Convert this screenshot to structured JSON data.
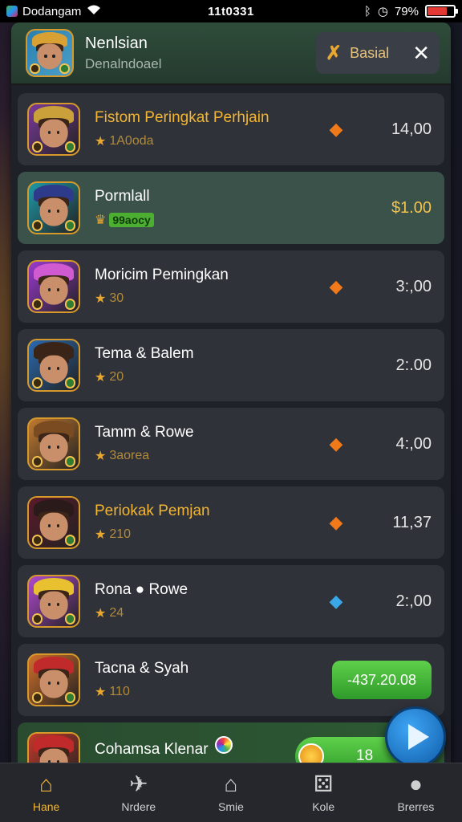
{
  "status_bar": {
    "carrier": "Dodangam",
    "time": "11t0331",
    "battery_text": "79%",
    "battery_level": 0.79
  },
  "header": {
    "title": "Nenlsian",
    "subtitle": "Denalndoael",
    "button_label": "Basial",
    "close_symbol": "✕"
  },
  "rows": [
    {
      "name": "Fistom Peringkat Perhjain",
      "sub": "1A0oda",
      "price": "14,00",
      "gem": "orange",
      "name_gold": true
    },
    {
      "name": "Pormlall",
      "sub": "99aocy",
      "price": "$1.00",
      "gem": "none",
      "name_gold": false,
      "selected": true,
      "price_gold": true
    },
    {
      "name": "Moricim Pemingkan",
      "sub": "30",
      "price": "3:,00",
      "gem": "orange",
      "name_gold": false
    },
    {
      "name": "Tema & Balem",
      "sub": "20",
      "price": "2:.00",
      "gem": "none",
      "name_gold": false
    },
    {
      "name": "Tamm & Rowe",
      "sub": "3aorea",
      "price": "4:,00",
      "gem": "orange",
      "name_gold": false
    },
    {
      "name": "Periokak Pemjan",
      "sub": "210",
      "price": "11,37",
      "gem": "orange",
      "name_gold": true
    },
    {
      "name": "Rona ● Rowe",
      "sub": "24",
      "price": "2:,00",
      "gem": "blue",
      "name_gold": false
    },
    {
      "name": "Tacna & Syah",
      "sub": "110",
      "button": "-437.20.08",
      "gem": "none",
      "name_gold": false
    },
    {
      "name": "Cohamsa Klenar",
      "sub": "",
      "coin_value": "18",
      "gem": "none",
      "name_gold": false
    }
  ],
  "tabs": [
    {
      "label": "Hane",
      "icon": "home-icon",
      "active": true
    },
    {
      "label": "Nrdere",
      "icon": "plane-icon",
      "active": false
    },
    {
      "label": "Smie",
      "icon": "house-icon",
      "active": false
    },
    {
      "label": "Kole",
      "icon": "dice-icon",
      "active": false
    },
    {
      "label": "Brerres",
      "icon": "circle-icon",
      "active": false
    }
  ],
  "colors": {
    "accent_gold": "#f2b533",
    "selected_row": "#3b524a",
    "green_button": "#4caf32",
    "fab_blue": "#1f7ad0"
  }
}
